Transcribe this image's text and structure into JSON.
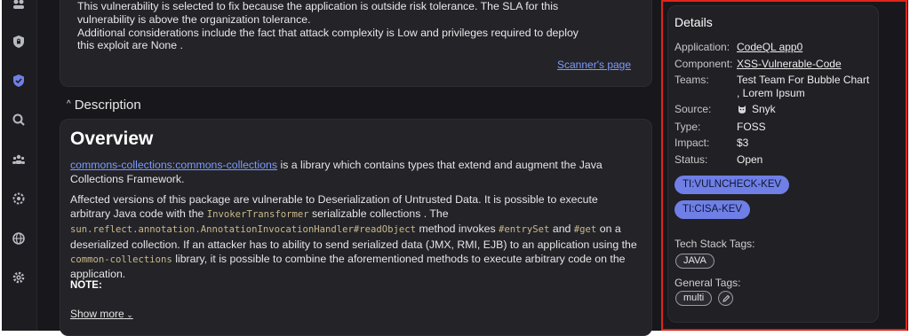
{
  "risk": {
    "line1": "This vulnerability is selected to fix because the application is outside risk tolerance. The SLA for this",
    "line2": "vulnerability is above the organization tolerance.",
    "line3": "Additional considerations include the fact that attack complexity is Low and privileges required to deploy",
    "line4": "this exploit are None .",
    "scanner_link": "Scanner's page"
  },
  "description": {
    "toggle_label": "Description",
    "overview_title": "Overview",
    "para1_link": "commons-collections:commons-collections",
    "para1_text": " is a library which contains types that extend and augment the Java Collections Framework.",
    "para2_a": "Affected versions of this package are vulnerable to Deserialization of Untrusted Data. It is possible to execute arbitrary Java code with the ",
    "para2_code1": "InvokerTransformer",
    "para2_b": " serializable collections . The ",
    "para2_code2": "sun.reflect.annotation.AnnotationInvocationHandler#readObject",
    "para2_c": " method invokes ",
    "para2_code3": "#entrySet",
    "para2_d": " and ",
    "para2_code4": "#get",
    "para2_e": " on a deserialized collection. If an attacker has to ability to send serialized data (JMX, RMI, EJB) to an application using the ",
    "para2_code5": "common-collections",
    "para2_f": " library, it is possible to combine the aforementioned methods to execute arbitrary code on the application.",
    "note": "NOTE:",
    "show_more": "Show more"
  },
  "details": {
    "title": "Details",
    "application_label": "Application:",
    "application_value": "CodeQL app0",
    "component_label": "Component:",
    "component_value": "XSS-Vulnerable-Code",
    "teams_label": "Teams:",
    "teams_value": "Test Team For Bubble Chart , Lorem Ipsum",
    "source_label": "Source:",
    "source_value": "Snyk",
    "type_label": "Type:",
    "type_value": "FOSS",
    "impact_label": "Impact:",
    "impact_value": "$3",
    "status_label": "Status:",
    "status_value": "Open",
    "kev_tags": [
      "TI:VULNCHECK-KEV",
      "TI:CISA-KEV"
    ],
    "tech_stack_label": "Tech Stack Tags:",
    "tech_stack_tags": [
      "JAVA"
    ],
    "general_label": "General Tags:",
    "general_tags": [
      "multi"
    ]
  },
  "colors": {
    "accent_link": "#7d9cff",
    "kev_chip": "#6f7fe6",
    "highlight_border": "#e2231a"
  }
}
